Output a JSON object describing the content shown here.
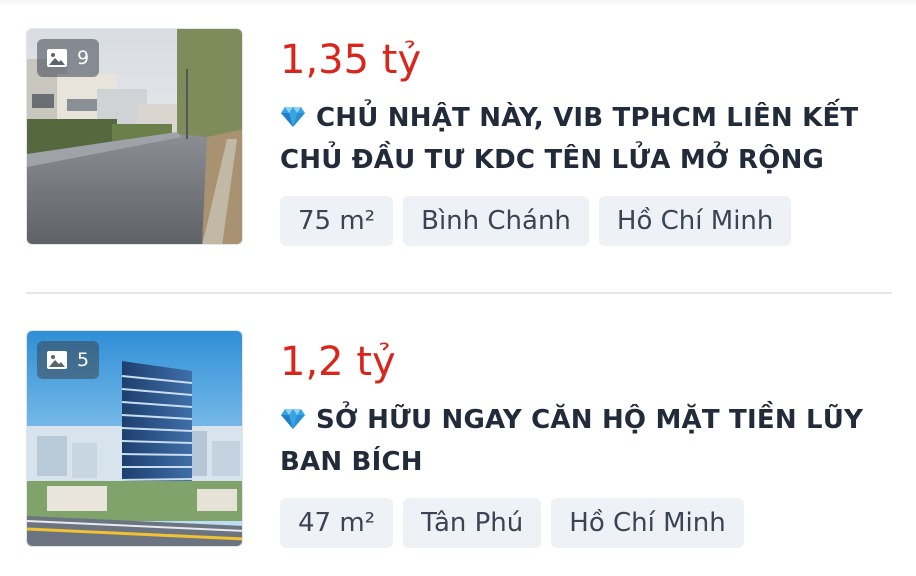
{
  "listings": [
    {
      "photo_count": "9",
      "price": "1,35 tỷ",
      "title": "CHỦ NHẬT NÀY, VIB TPHCM LIÊN KẾT CHỦ ĐẦU TƯ KDC TÊN LỬA MỞ RỘNG",
      "tags": [
        "75 m²",
        "Bình Chánh",
        "Hồ Chí Minh"
      ]
    },
    {
      "photo_count": "5",
      "price": "1,2 tỷ",
      "title": "SỞ HỮU NGAY CĂN HỘ MẶT TIỀN LŨY BAN BÍCH",
      "tags": [
        "47 m²",
        "Tân Phú",
        "Hồ Chí Minh"
      ]
    }
  ],
  "icons": {
    "photo": "image-icon",
    "vip": "diamond-icon"
  },
  "colors": {
    "price": "#d9261c",
    "title": "#222b3a",
    "tag_bg": "#eef2f7",
    "diamond": "#3aa3e3"
  }
}
